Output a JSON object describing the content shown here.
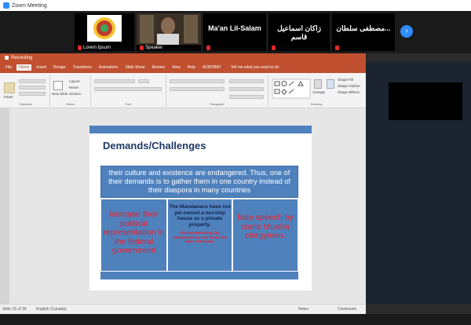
{
  "zoom": {
    "window_title": "Zoom Meeting"
  },
  "participants": [
    {
      "name": "Lorem Ipsum",
      "muted": true,
      "kind": "logo"
    },
    {
      "name": "Speaker",
      "muted": true,
      "kind": "video"
    },
    {
      "name": "Ma'an Lil-Salam",
      "muted": true,
      "kind": "name"
    },
    {
      "name": "زاكان اسماعيل قاسم",
      "muted": true,
      "kind": "name"
    },
    {
      "name": "مصطفى سلطان...",
      "muted": true,
      "kind": "name"
    }
  ],
  "ppt": {
    "window_title": "Recording",
    "tabs": [
      "File",
      "Home",
      "Insert",
      "Design",
      "Transitions",
      "Animations",
      "Slide Show",
      "Review",
      "View",
      "Help",
      "ACROBAT"
    ],
    "active_tab": "Home",
    "tell_me": "Tell me what you want to do",
    "ribbon_groups": [
      "Clipboard",
      "Slides",
      "Font",
      "Paragraph",
      "Drawing"
    ],
    "buttons": {
      "paste": "Paste",
      "new_slide": "New Slide",
      "layout": "Layout",
      "reset": "Reset",
      "section": "Section",
      "arrange": "Arrange",
      "quick_styles": "Quick Styles",
      "shape_fill": "Shape Fill",
      "shape_outline": "Shape Outline",
      "shape_effects": "Shape Effects"
    },
    "status": {
      "slide": "Slide 15 of 39",
      "lang": "English (Canada)",
      "notes": "Notes",
      "comments": "Comments"
    }
  },
  "slide": {
    "heading": "Demands/Challenges",
    "intro": "their culture and existence are endangered. Thus, one of their demands is to gather them in one country instead of their diaspora  in many countries",
    "cells": [
      {
        "text": "Increase their political representation in the federal government"
      },
      {
        "text": "The Mandaeans have not yet owned a worship house as a private property.",
        "small": "The law preventing any construction on their banks like taken of the land."
      },
      {
        "text": "hate speech by some Muslim clergymen."
      }
    ]
  },
  "colors": {
    "accent": "#c0502f",
    "slide_blue": "#4f81bd",
    "zoom_blue": "#2d8cff",
    "red_text": "#e8202b"
  }
}
